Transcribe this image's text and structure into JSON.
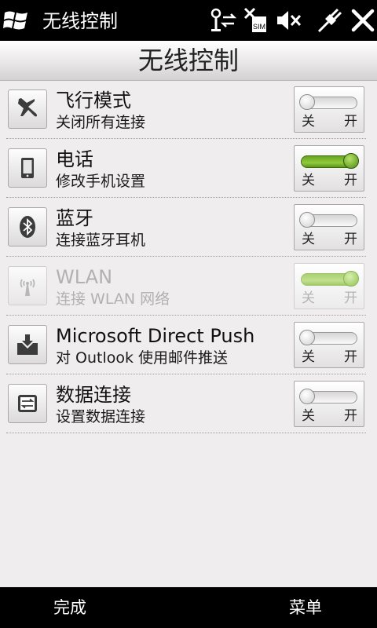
{
  "status_bar": {
    "title": "无线控制",
    "icons": [
      "windows-start-icon",
      "antenna-data-icon",
      "no-sim-icon",
      "volume-muted-icon",
      "usb-connection-icon",
      "close-icon"
    ]
  },
  "header": {
    "title": "无线控制"
  },
  "rows": [
    {
      "title": "飞行模式",
      "subtitle": "关闭所有连接",
      "icon": "airplane-icon",
      "state": "off",
      "enabled": true,
      "off_label": "关",
      "on_label": "开"
    },
    {
      "title": "电话",
      "subtitle": "修改手机设置",
      "icon": "phone-icon",
      "state": "on",
      "enabled": true,
      "off_label": "关",
      "on_label": "开"
    },
    {
      "title": "蓝牙",
      "subtitle": "连接蓝牙耳机",
      "icon": "bluetooth-icon",
      "state": "off",
      "enabled": true,
      "off_label": "关",
      "on_label": "开"
    },
    {
      "title": "WLAN",
      "subtitle": "连接 WLAN 网络",
      "icon": "wifi-icon",
      "state": "on",
      "enabled": false,
      "off_label": "关",
      "on_label": "开"
    },
    {
      "title": "Microsoft Direct Push",
      "subtitle": "对 Outlook 使用邮件推送",
      "icon": "mail-push-icon",
      "state": "off",
      "enabled": true,
      "off_label": "关",
      "on_label": "开"
    },
    {
      "title": "数据连接",
      "subtitle": "设置数据连接",
      "icon": "data-connection-icon",
      "state": "off",
      "enabled": true,
      "off_label": "关",
      "on_label": "开"
    }
  ],
  "softkeys": {
    "left": "完成",
    "right": "菜单"
  },
  "colors": {
    "background": "#efedee",
    "toggle_on": "#6aa321",
    "bar": "#000000"
  }
}
